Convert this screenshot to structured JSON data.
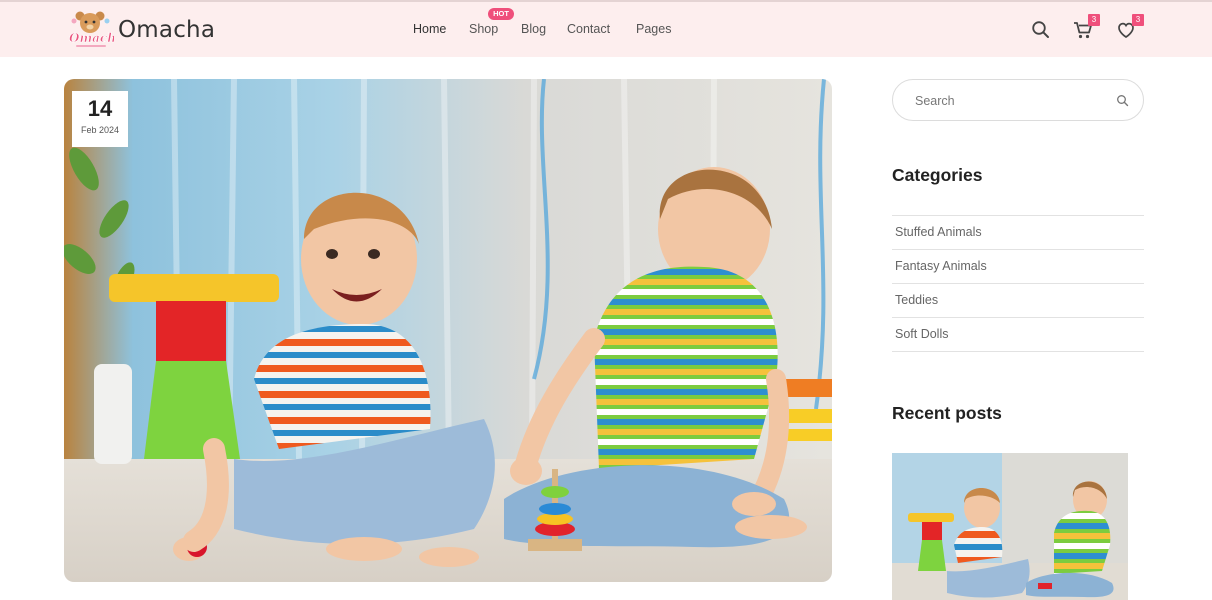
{
  "brand": {
    "name": "Omacha",
    "logo_text": "Omacha"
  },
  "nav": {
    "items": [
      {
        "label": "Home"
      },
      {
        "label": "Shop"
      },
      {
        "label": "Blog"
      },
      {
        "label": "Contact"
      },
      {
        "label": "Pages"
      }
    ],
    "badge": "HOT"
  },
  "header_icons": {
    "search": "search-icon",
    "cart": "cart-icon",
    "cart_count": "3",
    "wishlist": "heart-icon",
    "wishlist_count": "3"
  },
  "post": {
    "date_day": "14",
    "date_month": "Feb 2024",
    "image": "two toddlers in striped shirts playing with a ring stacking toy"
  },
  "sidebar": {
    "search_placeholder": "Search",
    "categories_title": "Categories",
    "categories": [
      "Stuffed Animals",
      "Fantasy Animals",
      "Teddies",
      "Soft Dolls"
    ],
    "recent_title": "Recent posts"
  },
  "colors": {
    "header_bg": "#fdeeee",
    "accent": "#ef4f7b",
    "text": "#2b2b2b"
  }
}
